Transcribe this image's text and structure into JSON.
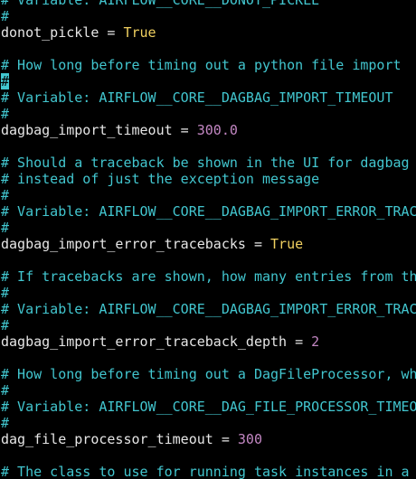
{
  "colors": {
    "background": "#000000",
    "comment": "#42c6cf",
    "key": "#e6e6e6",
    "bool_value": "#f0d060",
    "number_value": "#c387c3",
    "cursor": "#42c6cf"
  },
  "lines": [
    {
      "type": "comment",
      "text": "# Variable: AIRFLOW__CORE__DONOT_PICKLE"
    },
    {
      "type": "comment",
      "text": "#"
    },
    {
      "type": "kv",
      "key": "donot_pickle",
      "op": " = ",
      "value": "True",
      "vtype": "bool"
    },
    {
      "type": "blank",
      "text": ""
    },
    {
      "type": "comment",
      "text": "# How long before timing out a python file import"
    },
    {
      "type": "cursor-comment",
      "text": "#"
    },
    {
      "type": "comment",
      "text": "# Variable: AIRFLOW__CORE__DAGBAG_IMPORT_TIMEOUT"
    },
    {
      "type": "comment",
      "text": "#"
    },
    {
      "type": "kv",
      "key": "dagbag_import_timeout",
      "op": " = ",
      "value": "300.0",
      "vtype": "num"
    },
    {
      "type": "blank",
      "text": ""
    },
    {
      "type": "comment",
      "text": "# Should a traceback be shown in the UI for dagbag import errors,"
    },
    {
      "type": "comment",
      "text": "# instead of just the exception message"
    },
    {
      "type": "comment",
      "text": "#"
    },
    {
      "type": "comment",
      "text": "# Variable: AIRFLOW__CORE__DAGBAG_IMPORT_ERROR_TRACEBACKS"
    },
    {
      "type": "comment",
      "text": "#"
    },
    {
      "type": "kv",
      "key": "dagbag_import_error_tracebacks",
      "op": " = ",
      "value": "True",
      "vtype": "bool"
    },
    {
      "type": "blank",
      "text": ""
    },
    {
      "type": "comment",
      "text": "# If tracebacks are shown, how many entries from the traceback should be shown"
    },
    {
      "type": "comment",
      "text": "#"
    },
    {
      "type": "comment",
      "text": "# Variable: AIRFLOW__CORE__DAGBAG_IMPORT_ERROR_TRACEBACK_DEPTH"
    },
    {
      "type": "comment",
      "text": "#"
    },
    {
      "type": "kv",
      "key": "dagbag_import_error_traceback_depth",
      "op": " = ",
      "value": "2",
      "vtype": "num"
    },
    {
      "type": "blank",
      "text": ""
    },
    {
      "type": "comment",
      "text": "# How long before timing out a DagFileProcessor, which processes a dag file"
    },
    {
      "type": "comment",
      "text": "#"
    },
    {
      "type": "comment",
      "text": "# Variable: AIRFLOW__CORE__DAG_FILE_PROCESSOR_TIMEOUT"
    },
    {
      "type": "comment",
      "text": "#"
    },
    {
      "type": "kv",
      "key": "dag_file_processor_timeout",
      "op": " = ",
      "value": "300",
      "vtype": "num"
    },
    {
      "type": "blank",
      "text": ""
    },
    {
      "type": "comment",
      "text": "# The class to use for running task instances in a subprocess."
    }
  ]
}
